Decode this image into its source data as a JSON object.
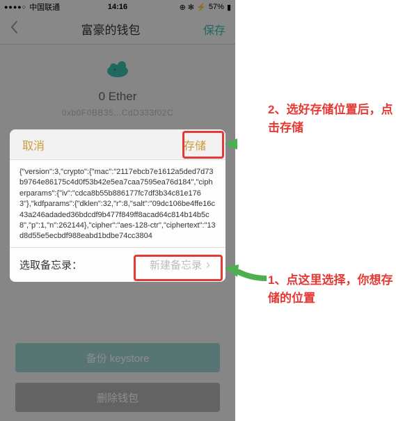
{
  "status": {
    "signal_dots": "●●●●○",
    "carrier": "中国联通",
    "time": "14:16",
    "battery_pct": "57%",
    "icons": "⊕ ⏰ ⚡"
  },
  "nav": {
    "title": "富豪的钱包",
    "save": "保存"
  },
  "wallet": {
    "balance": "0 Ether",
    "address": "0xb0F0BB35...CdD333f02C"
  },
  "modal": {
    "cancel": "取消",
    "store": "存储",
    "json_text": "{\"version\":3,\"crypto\":{\"mac\":\"2117ebcb7e1612a5ded7d73b9764e86175c4d0f53b42e5ea7caa7595ea76d184\",\"cipherparams\":{\"iv\":\"cdca8b55b886177fc7df3b34c81e1763\"},\"kdfparams\":{\"dklen\":32,\"r\":8,\"salt\":\"09dc106be4ffe16c43a246adaded36bdcdf9b477f849ff8acad64c814b14b5c8\",\"p\":1,\"n\":262144},\"cipher\":\"aes-128-ctr\",\"ciphertext\":\"13d8d55e5ecbdf988eabd1bdbe74cc3804",
    "memo_label": "选取备忘录：",
    "memo_placeholder": "新建备忘录"
  },
  "buttons": {
    "backup": "备份 keystore",
    "delete": "删除钱包"
  },
  "annotations": {
    "step2": "2、选好存储位置后，点击存储",
    "step1": "1、点这里选择，你想存储的位置"
  }
}
